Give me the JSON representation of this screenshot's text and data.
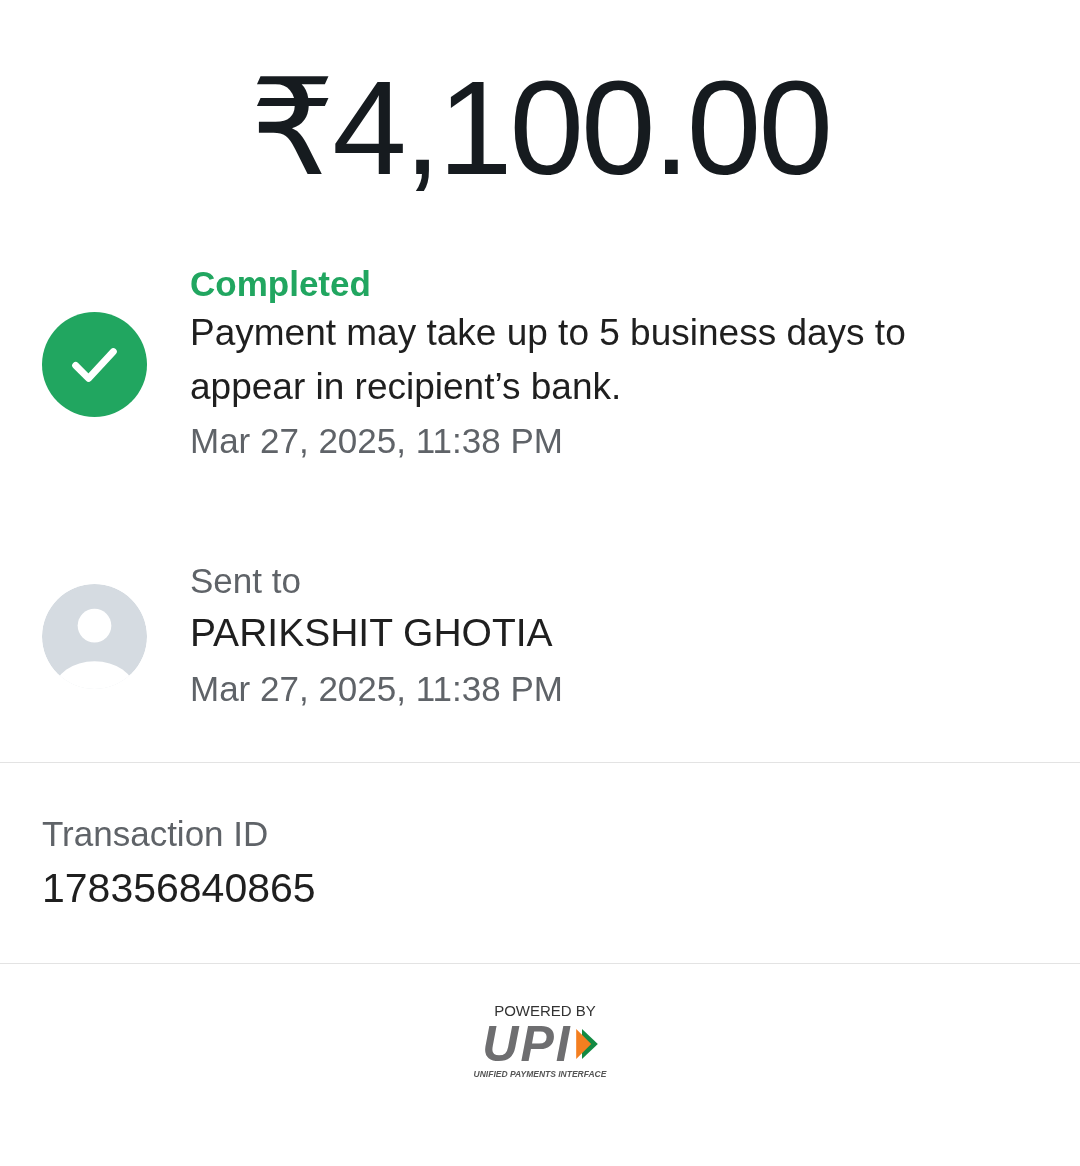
{
  "amount": "₹4,100.00",
  "status": {
    "kind": "completed",
    "label": "Completed",
    "message": "Payment may take up to 5 business days to appear in recipient’s bank.",
    "time": "Mar 27, 2025, 11:38 PM"
  },
  "recipient": {
    "label": "Sent to",
    "name": "PARIKSHIT GHOTIA",
    "time": "Mar 27, 2025, 11:38 PM"
  },
  "transaction": {
    "label": "Transaction ID",
    "value": "178356840865"
  },
  "footer": {
    "powered_by": "POWERED BY",
    "brand": "UPI",
    "tagline": "UNIFIED PAYMENTS INTERFACE"
  }
}
